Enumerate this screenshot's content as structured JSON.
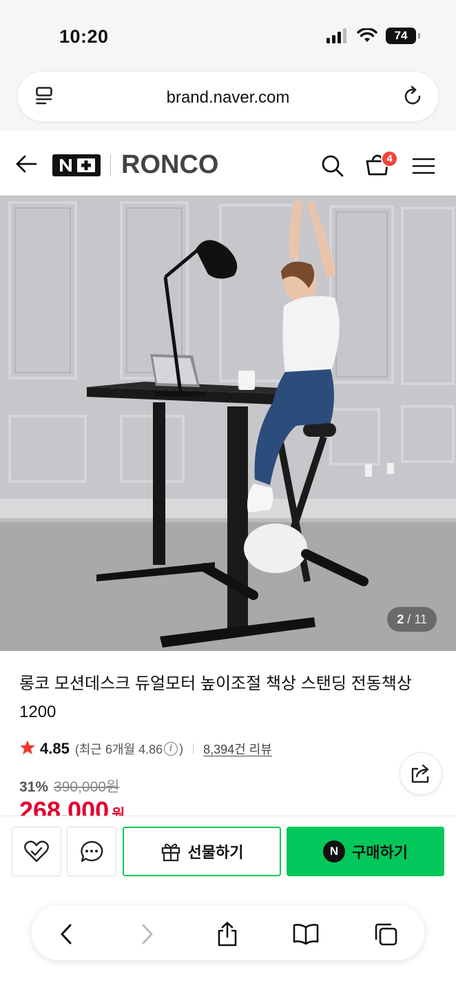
{
  "status_bar": {
    "time": "10:20",
    "battery": "74"
  },
  "browser": {
    "url": "brand.naver.com"
  },
  "header": {
    "store_badge": "N+",
    "brand": "RONCO",
    "cart_count": "4"
  },
  "gallery": {
    "current": "2",
    "separator": "/",
    "total": "11"
  },
  "product": {
    "title": "롱코 모션데스크 듀얼모터 높이조절 책상 스탠딩 전동책상 1200",
    "rating": "4.85",
    "recent_rating": "(최근 6개월 4.86",
    "recent_rating_close": ")",
    "info_icon": "i",
    "review_count": "8,394건 리뷰",
    "discount_rate": "31%",
    "original_price": "390,000원",
    "sale_price": "268,000",
    "currency": "원"
  },
  "actions": {
    "gift_label": "선물하기",
    "buy_label": "구매하기",
    "npay_badge": "N"
  },
  "colors": {
    "accent_green": "#03c75a",
    "price_red": "#e1002d",
    "badge_red": "#f0443a"
  },
  "icons": [
    "tabs-icon",
    "reload-icon",
    "back-arrow-icon",
    "search-icon",
    "cart-icon",
    "menu-icon",
    "star-icon",
    "share-icon",
    "heart-icon",
    "talk-icon",
    "gift-icon",
    "nav-back-icon",
    "nav-forward-icon",
    "share-sheet-icon",
    "bookmarks-icon",
    "tabs-overview-icon"
  ]
}
